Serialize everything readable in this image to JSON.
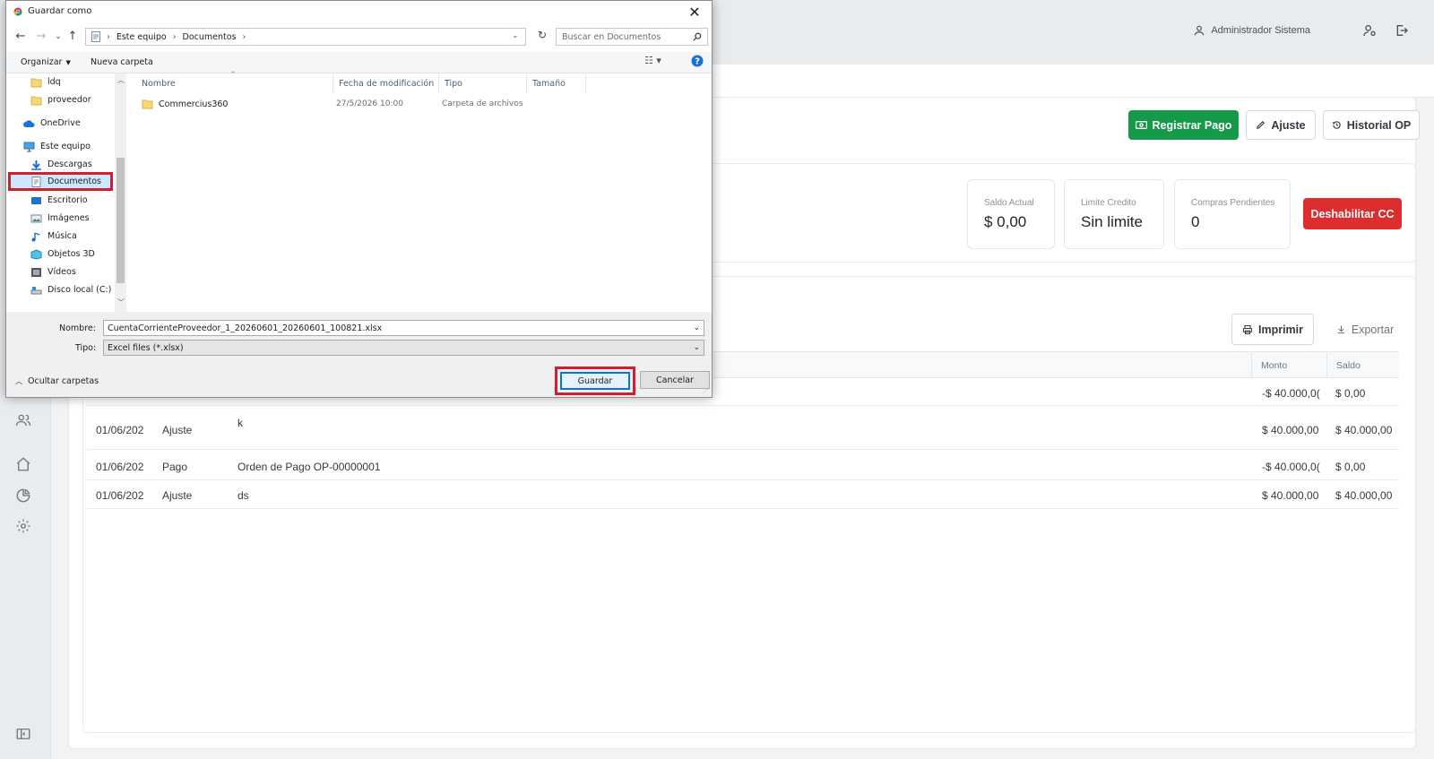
{
  "dialog": {
    "title": "Guardar como",
    "address": {
      "root": "Este equipo",
      "current": "Documentos"
    },
    "search_placeholder": "Buscar en Documentos",
    "organize_label": "Organizar",
    "new_folder_label": "Nueva carpeta",
    "tree": [
      {
        "label": "ldq",
        "icon": "folder-icon"
      },
      {
        "label": "proveedor",
        "icon": "folder-icon"
      },
      {
        "label": "OneDrive",
        "icon": "cloud-icon"
      },
      {
        "label": "Este equipo",
        "icon": "computer-icon"
      },
      {
        "label": "Descargas",
        "icon": "download-icon"
      },
      {
        "label": "Documentos",
        "icon": "document-icon",
        "selected": true
      },
      {
        "label": "Escritorio",
        "icon": "desktop-icon"
      },
      {
        "label": "Imágenes",
        "icon": "image-icon"
      },
      {
        "label": "Música",
        "icon": "music-icon"
      },
      {
        "label": "Objetos 3D",
        "icon": "cube-icon"
      },
      {
        "label": "Vídeos",
        "icon": "video-icon"
      },
      {
        "label": "Disco local (C:)",
        "icon": "disk-icon"
      }
    ],
    "columns": [
      "Nombre",
      "Fecha de modificación",
      "Tipo",
      "Tamaño"
    ],
    "files": [
      {
        "name": "Commercius360",
        "modified": "27/5/2026 10:00",
        "type": "Carpeta de archivos",
        "size": ""
      }
    ],
    "filename_label": "Nombre:",
    "filename_value": "CuentaCorrienteProveedor_1_20260601_20260601_100821.xlsx",
    "filetype_label": "Tipo:",
    "filetype_value": "Excel files (*.xlsx)",
    "hide_folders_label": "Ocultar carpetas",
    "save_label": "Guardar",
    "cancel_label": "Cancelar",
    "highlight_color": "#d1202b"
  },
  "app": {
    "user_name": "Administrador Sistema",
    "actions": {
      "register_payment": "Registrar Pago",
      "adjust": "Ajuste",
      "history": "Historial OP"
    },
    "stats": [
      {
        "label": "Saldo Actual",
        "value": "$ 0,00"
      },
      {
        "label": "Limite Credito",
        "value": "Sin limite"
      },
      {
        "label": "Compras Pendientes",
        "value": "0"
      }
    ],
    "disable_cc": "Deshabilitar CC",
    "print_label": "Imprimir",
    "export_label": "Exportar",
    "table_headers": {
      "amount": "Monto",
      "balance": "Saldo"
    },
    "rows": [
      {
        "date": "",
        "type": "",
        "desc": "",
        "amount": "-$ 40.000,0(",
        "balance": "$ 0,00"
      },
      {
        "date": "01/06/202",
        "type": "Ajuste",
        "desc": "k",
        "amount": "$ 40.000,00",
        "balance": "$ 40.000,00"
      },
      {
        "date": "01/06/202",
        "type": "Pago",
        "desc": "Orden de Pago OP-00000001",
        "amount": "-$ 40.000,0(",
        "balance": "$ 0,00"
      },
      {
        "date": "01/06/202",
        "type": "Ajuste",
        "desc": "ds",
        "amount": "$ 40.000,00",
        "balance": "$ 40.000,00"
      }
    ],
    "colors": {
      "green": "#159a4a",
      "red": "#dc2e2e"
    }
  }
}
